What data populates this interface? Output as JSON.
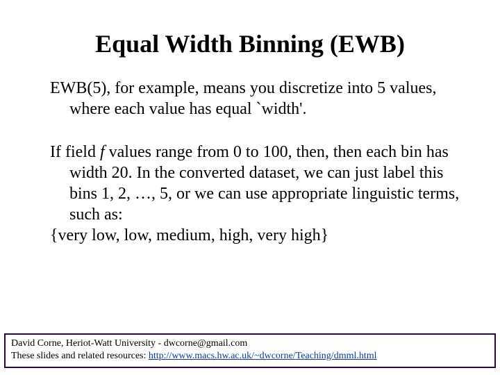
{
  "title": "Equal Width Binning (EWB)",
  "para1": "EWB(5), for example, means you discretize into 5 values, where each value has equal `width'.",
  "para2_pre": "If field ",
  "para2_f": "f",
  "para2_post": " values range from 0 to 100, then, then each bin has width 20. In the converted dataset, we can just label this bins 1, 2, …, 5, or we can use appropriate linguistic terms, such as:",
  "para3": "{very low, low, medium, high, very high}",
  "footer_line1": "David Corne,  Heriot-Watt University  -  dwcorne@gmail.com",
  "footer_line2_pre": "These slides and related resources:  ",
  "footer_link": "http://www.macs.hw.ac.uk/~dwcorne/Teaching/dmml.html"
}
